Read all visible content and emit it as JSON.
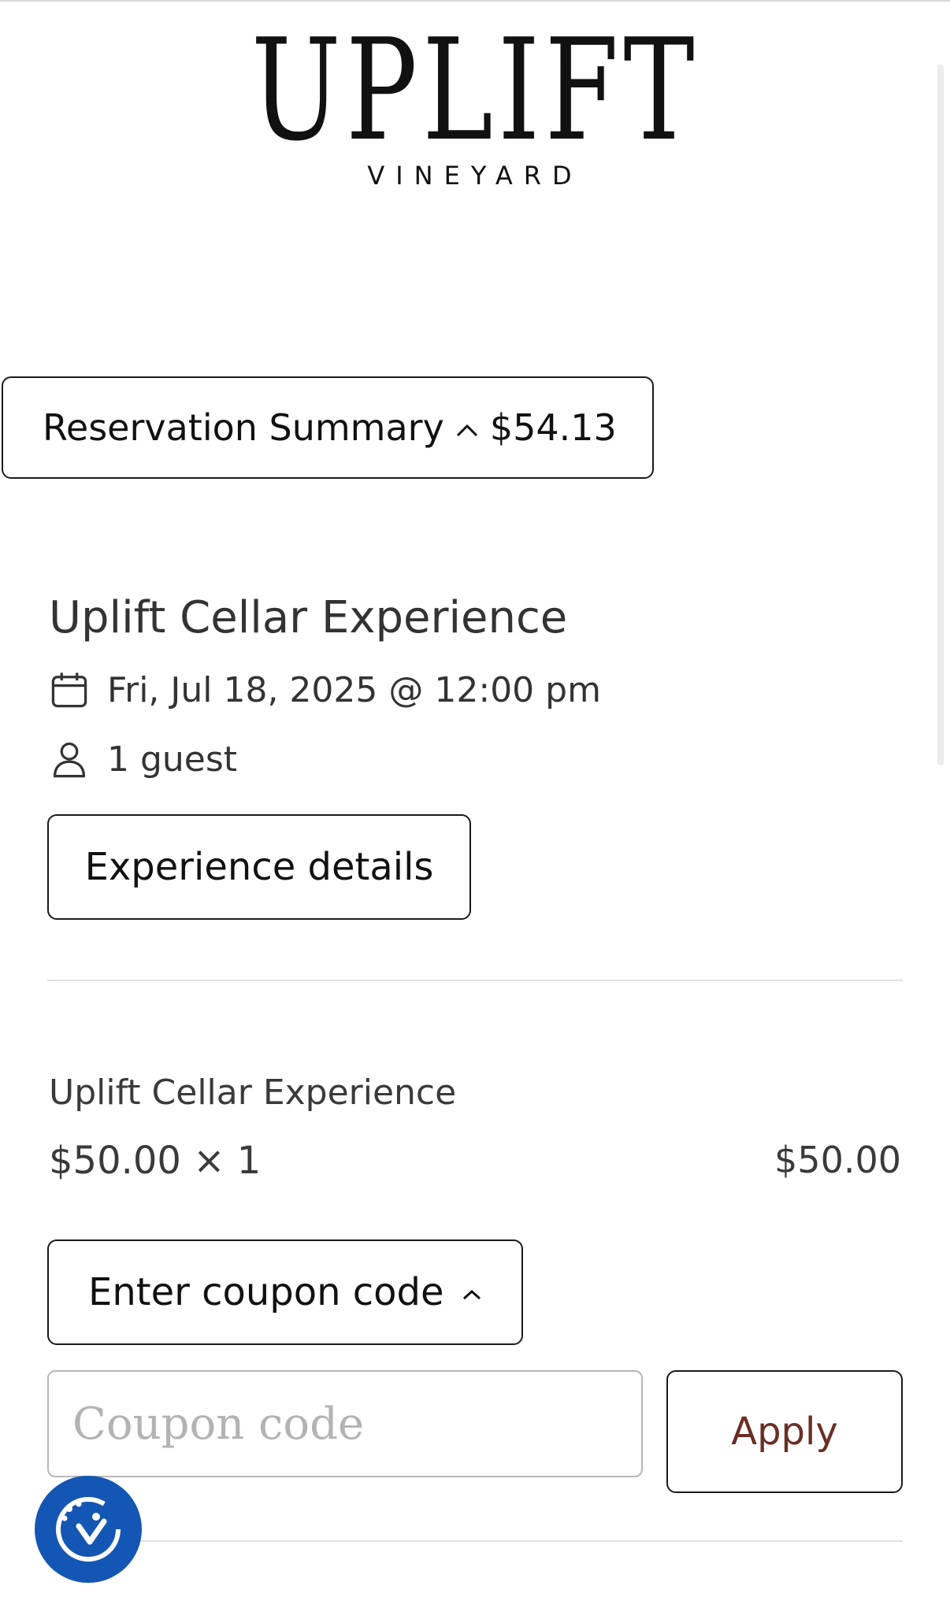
{
  "brand": {
    "name": "UPLIFT",
    "subtitle": "VINEYARD"
  },
  "summary": {
    "label": "Reservation Summary",
    "caret_icon": "chevron-up-icon",
    "total": "$54.13"
  },
  "experience": {
    "title": "Uplift Cellar Experience",
    "date": "Fri, Jul 18, 2025 @ 12:00 pm",
    "guests": "1 guest",
    "details_button": "Experience details"
  },
  "line_item": {
    "name": "Uplift Cellar Experience",
    "price_qty": "$50.00 × 1",
    "amount": "$50.00"
  },
  "coupon": {
    "toggle_label": "Enter coupon code",
    "input_placeholder": "Coupon code",
    "input_value": "",
    "apply_label": "Apply"
  },
  "accessibility": {
    "icon": "accessibility-icon",
    "color": "#1456b4"
  }
}
